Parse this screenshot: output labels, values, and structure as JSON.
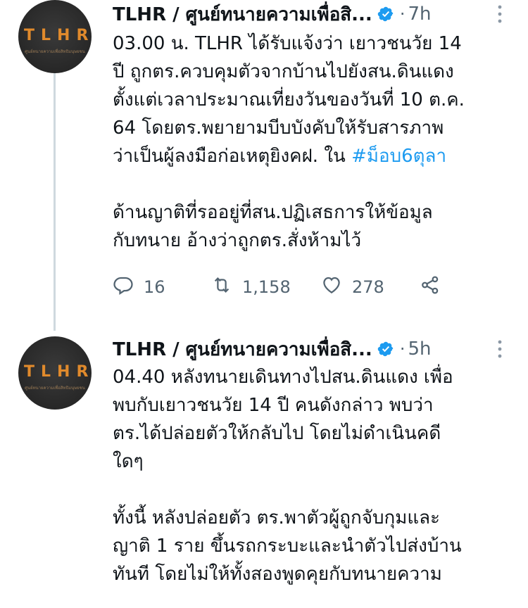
{
  "tweets": [
    {
      "avatar": {
        "logo_text": "TLHR",
        "logo_subtext": "ศูนย์ทนายความเพื่อสิทธิมนุษยชน"
      },
      "author_name": "TLHR / ศูนย์ทนายความเพื่อสิ...",
      "separator": "·",
      "time": "7h",
      "more_icon": "more-vertical-icon",
      "lines": [
        "03.00 น. TLHR ได้รับแจ้งว่า เยาวชนวัย 14",
        "ปี ถูกตร.ควบคุมตัวจากบ้านไปยังสน.ดินแดง",
        "ตั้งแต่เวลาประมาณเที่ยงวันของวันที่ 10 ต.ค.",
        "64 โดยตร.พยายามบีบบังคับให้รับสารภาพ"
      ],
      "line5_text": "ว่าเป็นผู้ลงมือก่อเหตุยิงคฝ. ใน ",
      "hashtag": "#ม็อบ6ตุลา",
      "lines2": [
        "ด้านญาติที่รออยู่ที่สน.ปฏิเสธการให้ข้อมูล",
        "กับทนาย อ้างว่าถูกตร.สั่งห้ามไว้"
      ],
      "actions": {
        "reply_count": "16",
        "retweet_count": "1,158",
        "like_count": "278"
      }
    },
    {
      "avatar": {
        "logo_text": "TLHR",
        "logo_subtext": "ศูนย์ทนายความเพื่อสิทธิมนุษยชน"
      },
      "author_name": "TLHR / ศูนย์ทนายความเพื่อสิ...",
      "separator": "·",
      "time": "5h",
      "more_icon": "more-vertical-icon",
      "lines": [
        "04.40 หลังทนายเดินทางไปสน.ดินแดง เพื่อ",
        "พบกับเยาวชนวัย 14 ปี คนดังกล่าว พบว่า",
        "ตร.ได้ปล่อยตัวให้กลับไป โดยไม่ดำเนินคดี",
        "ใดๆ"
      ],
      "lines2": [
        "ทั้งนี้ หลังปล่อยตัว ตร.พาตัวผู้ถูกจับกุมและ",
        "ญาติ 1 ราย ขึ้นรถกระบะและนำตัวไปส่งบ้าน",
        "ทันที โดยไม่ให้ทั้งสองพูดคุยกับทนายความ"
      ]
    }
  ],
  "colors": {
    "link": "#1d9bf0",
    "muted": "#536471",
    "verified": "#1d9bf0",
    "logo": "#e08a2c"
  }
}
